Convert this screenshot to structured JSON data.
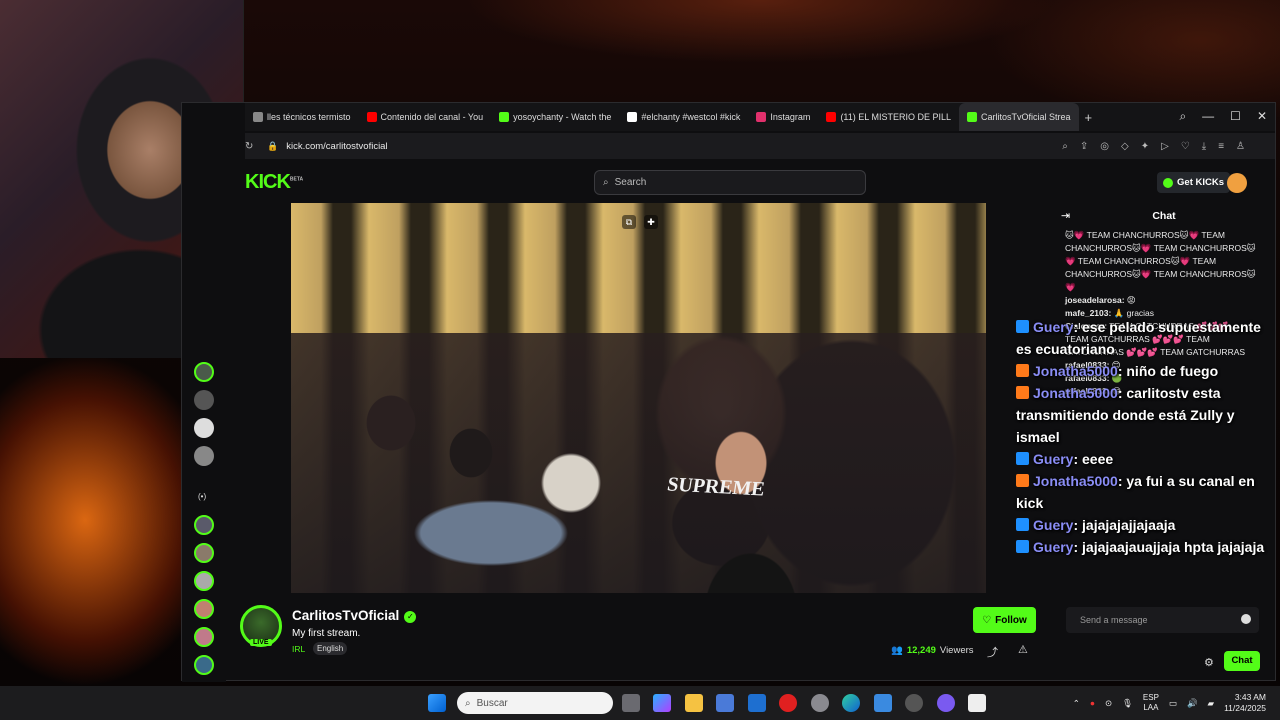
{
  "browser": {
    "tabs": [
      {
        "label": "lles técnicos termisto",
        "color": "#888888"
      },
      {
        "label": "Contenido del canal - You",
        "color": "#ff0000"
      },
      {
        "label": "yosoychanty - Watch the",
        "color": "#53fc18"
      },
      {
        "label": "#elchanty #westcol #kick",
        "color": "#ffffff"
      },
      {
        "label": "Instagram",
        "color": "#e1306c"
      },
      {
        "label": "(11) EL MISTERIO DE PILL",
        "color": "#ff0000"
      },
      {
        "label": "CarlitosTvOficial Strea",
        "color": "#53fc18",
        "active": true
      }
    ],
    "url": "kick.com/carlitostvoficial"
  },
  "kick": {
    "logo": "KICK",
    "logo_sup": "BETA",
    "search_placeholder": "Search",
    "get_kicks_label": "Get KICKs"
  },
  "channel": {
    "name": "CarlitosTvOficial",
    "stream_title": "My first stream.",
    "category": "IRL",
    "language_tag": "English",
    "live_label": "LIVE",
    "follow_label": "Follow",
    "viewers_count": "12,249",
    "viewers_label": "Viewers"
  },
  "video": {
    "shirt_text": "SUPREME"
  },
  "chat": {
    "title": "Chat",
    "messages": [
      {
        "user": "",
        "text": "🐱💗 TEAM CHANCHURROS🐱💗 TEAM CHANCHURROS🐱💗 TEAM CHANCHURROS🐱💗 TEAM CHANCHURROS🐱💗 TEAM CHANCHURROS🐱💗 TEAM CHANCHURROS🐱💗"
      },
      {
        "user": "joseadelarosa:",
        "text": "😡"
      },
      {
        "user": "mafe_2103:",
        "text": "🙏 gracias"
      },
      {
        "user": "Cialonsor:",
        "text": "TEAM GATCHURRAS 💕💕💕"
      },
      {
        "user": "",
        "text": "TEAM GATCHURRAS 💕💕💕 TEAM GATCHURRAS 💕💕💕 TEAM GATCHURRAS"
      },
      {
        "user": "rafael0833:",
        "text": "😊"
      },
      {
        "user": "rafael0833:",
        "text": "🟢"
      },
      {
        "user": "rafael0833:",
        "text": "😂"
      }
    ],
    "input_placeholder": "Send a message",
    "send_label": "Chat"
  },
  "overlay_chat": [
    {
      "user": "Guery",
      "text": ": ese pelado supuestamente es ecuatoriano",
      "badge_color": "#1e90ff"
    },
    {
      "user": "Jonatha5000",
      "text": ": niño de fuego",
      "badge_color": "#ff7a1a"
    },
    {
      "user": "Jonatha5000",
      "text": ": carlitostv esta transmitiendo donde está Zully y ismael",
      "badge_color": "#ff7a1a"
    },
    {
      "user": "Guery",
      "text": ": eeee",
      "badge_color": "#1e90ff"
    },
    {
      "user": "Jonatha5000",
      "text": ": ya fui a su canal en kick",
      "badge_color": "#ff7a1a"
    },
    {
      "user": "Guery",
      "text": ": jajajajajjajaaja",
      "badge_color": "#1e90ff"
    },
    {
      "user": "Guery",
      "text": ": jajajaajauajjaja hpta jajajaja",
      "badge_color": "#1e90ff"
    }
  ],
  "taskbar": {
    "search_placeholder": "Buscar",
    "lang_line1": "ESP",
    "lang_line2": "LAA",
    "time": "3:43 AM",
    "date": "11/24/2025"
  }
}
